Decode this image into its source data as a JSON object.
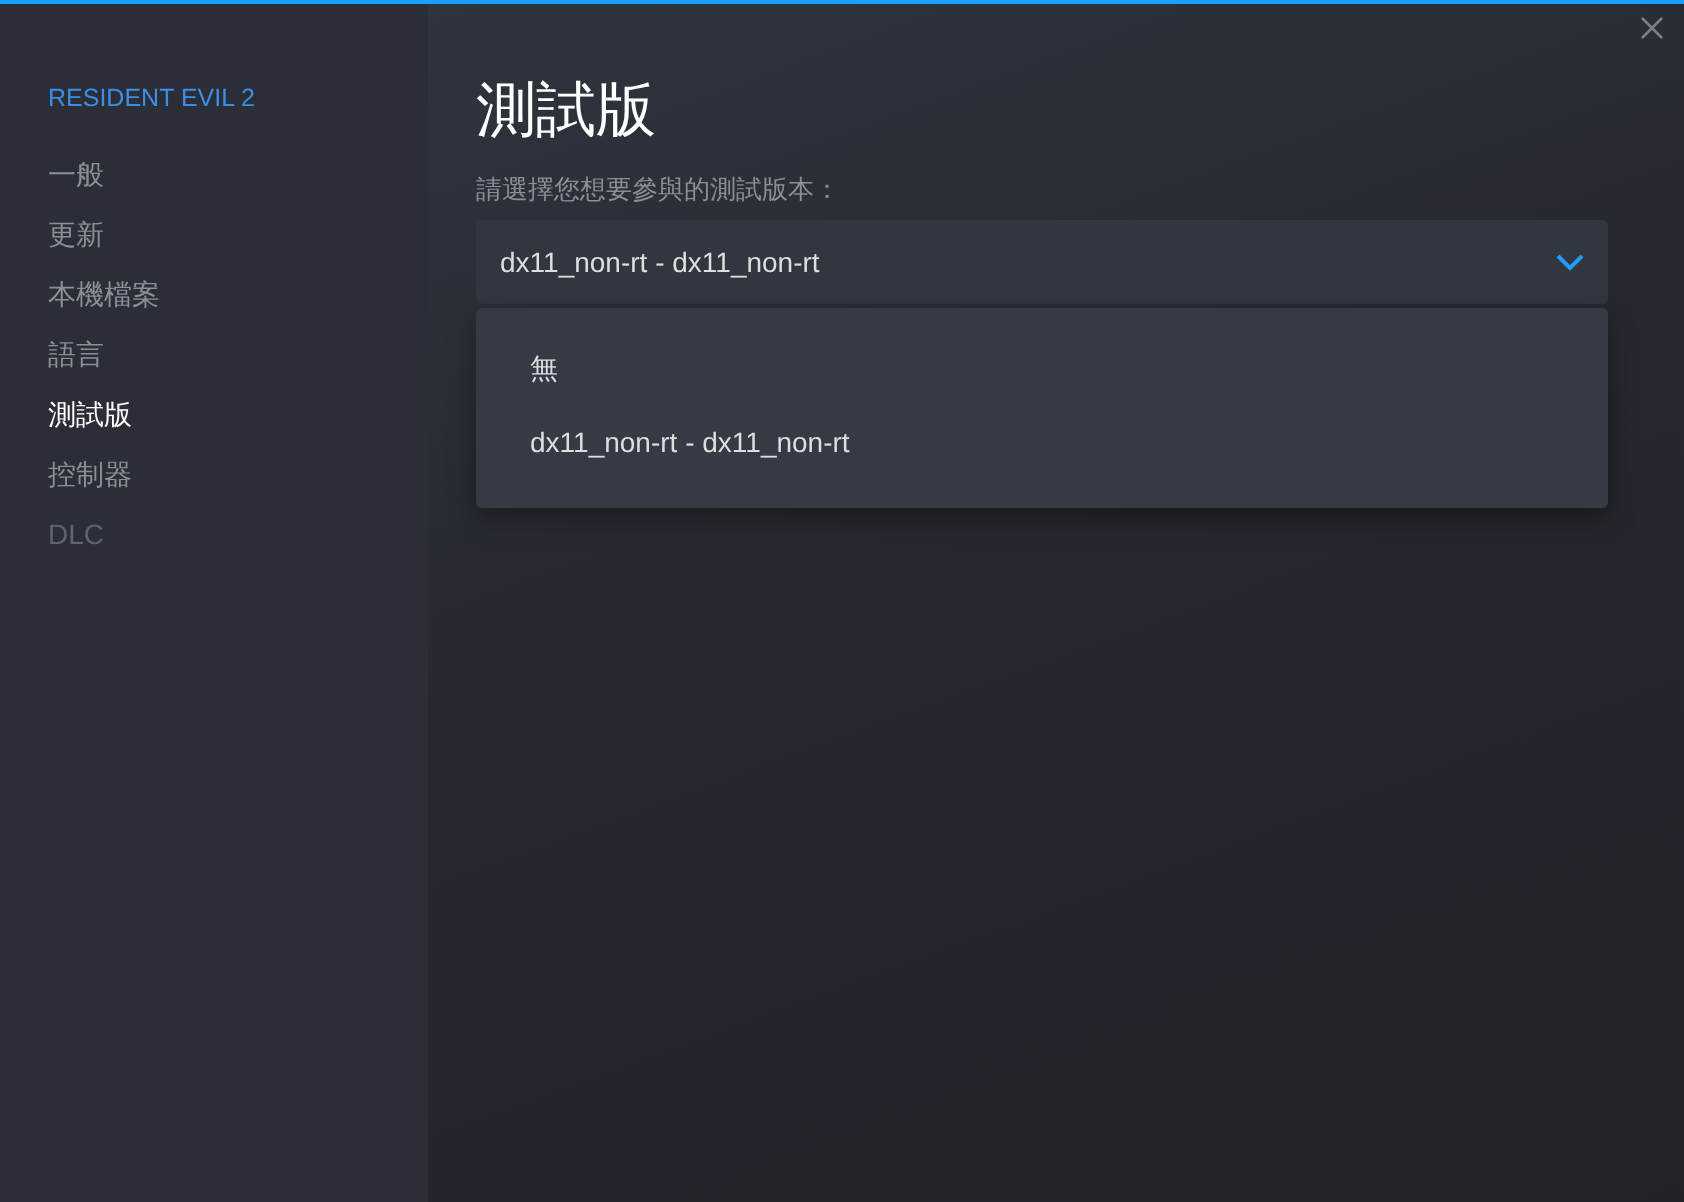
{
  "sidebar": {
    "title": "RESIDENT EVIL 2",
    "items": [
      {
        "label": "一般",
        "selected": false,
        "disabled": false
      },
      {
        "label": "更新",
        "selected": false,
        "disabled": false
      },
      {
        "label": "本機檔案",
        "selected": false,
        "disabled": false
      },
      {
        "label": "語言",
        "selected": false,
        "disabled": false
      },
      {
        "label": "測試版",
        "selected": true,
        "disabled": false
      },
      {
        "label": "控制器",
        "selected": false,
        "disabled": false
      },
      {
        "label": "DLC",
        "selected": false,
        "disabled": true
      }
    ]
  },
  "page": {
    "title": "測試版",
    "prompt": "請選擇您想要參與的測試版本：",
    "dropdown": {
      "value": "dx11_non-rt - dx11_non-rt",
      "options": [
        "無",
        "dx11_non-rt - dx11_non-rt"
      ]
    }
  }
}
